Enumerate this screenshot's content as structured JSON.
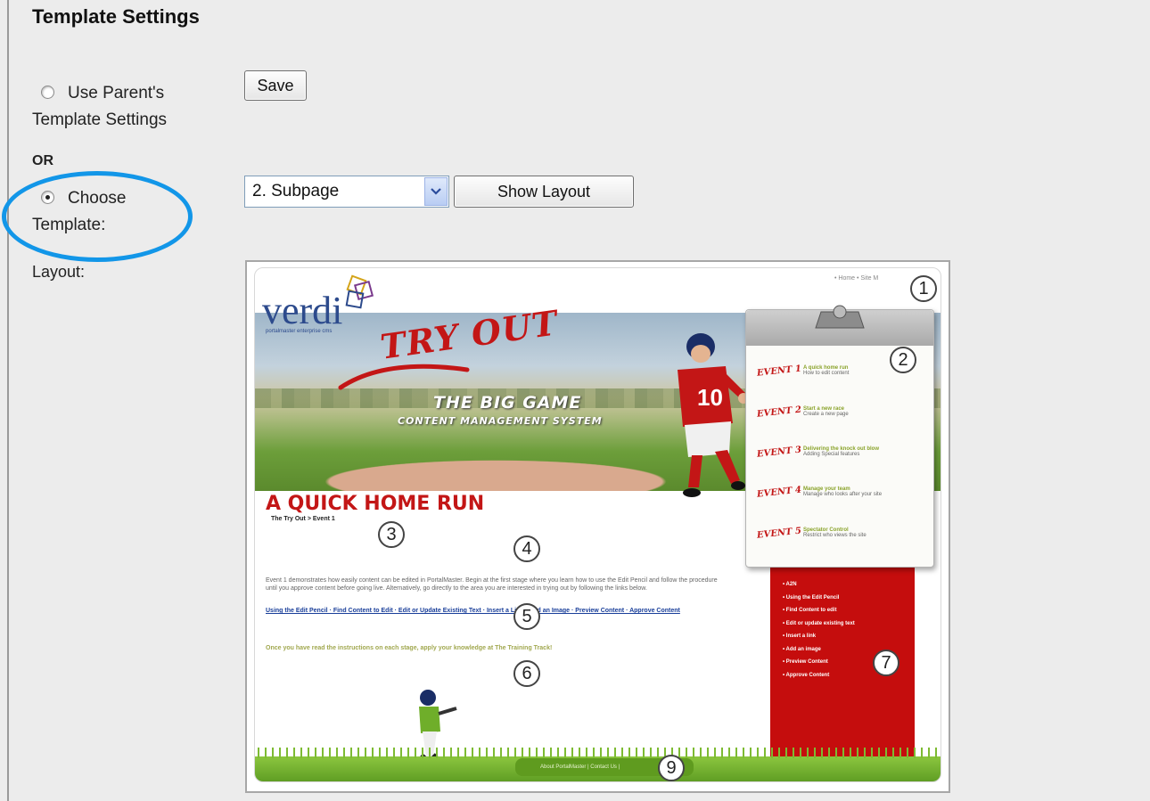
{
  "section": {
    "title": "Template Settings"
  },
  "options": {
    "use_parent_line1": "Use Parent's",
    "use_parent_line2": "Template Settings",
    "or_label": "OR",
    "choose_line1": "Choose",
    "choose_line2": "Template:",
    "layout_label": "Layout:"
  },
  "buttons": {
    "save": "Save",
    "show_layout": "Show Layout"
  },
  "template_select": {
    "selected": "2. Subpage"
  },
  "preview": {
    "logo_text": "verdi",
    "logo_tagline": "portalmaster enterprise cms",
    "tryout": "TRY OUT",
    "hero_title": "THE BIG GAME",
    "hero_subtitle": "CONTENT MANAGEMENT SYSTEM",
    "top_links": "• Home  • Site M",
    "jersey_number": "10",
    "page_heading": "A QUICK HOME RUN",
    "breadcrumb": "The Try Out > Event 1",
    "body_text": "Event 1 demonstrates how easily content can be edited in PortalMaster. Begin at the first stage where you learn how to use the Edit Pencil and follow the procedure until you approve content before going live. Alternatively, go directly to the area you are interested in trying out by following the links below.",
    "body_links": "Using the Edit Pencil · Find Content to Edit · Edit or Update Existing Text · Insert a Link · Add an Image · Preview Content · Approve Content",
    "body_note": "Once you have read the instructions on each stage, apply your knowledge at The Training Track!",
    "events": [
      {
        "tag": "EVENT 1",
        "title": "A quick home run",
        "desc": "How to edit content"
      },
      {
        "tag": "EVENT 2",
        "title": "Start a new race",
        "desc": "Create a new page"
      },
      {
        "tag": "EVENT 3",
        "title": "Delivering the knock out blow",
        "desc": "Adding Special features"
      },
      {
        "tag": "EVENT 4",
        "title": "Manage your team",
        "desc": "Manage who looks after your site"
      },
      {
        "tag": "EVENT 5",
        "title": "Spectator Control",
        "desc": "Restrict who views the site"
      }
    ],
    "nav_items": [
      "A2N",
      "Using the Edit Pencil",
      "Find Content to edit",
      "Edit or update existing text",
      "Insert a link",
      "Add an image",
      "Preview Content",
      "Approve Content"
    ],
    "footer_text": "About PortalMaster | Contact Us |",
    "markers": [
      "1",
      "2",
      "3",
      "4",
      "5",
      "6",
      "7",
      "9"
    ]
  },
  "colors": {
    "highlight": "#1296e8",
    "brand_red": "#c31616",
    "brand_blue": "#2c4a8c",
    "grass": "#5c9b22"
  }
}
